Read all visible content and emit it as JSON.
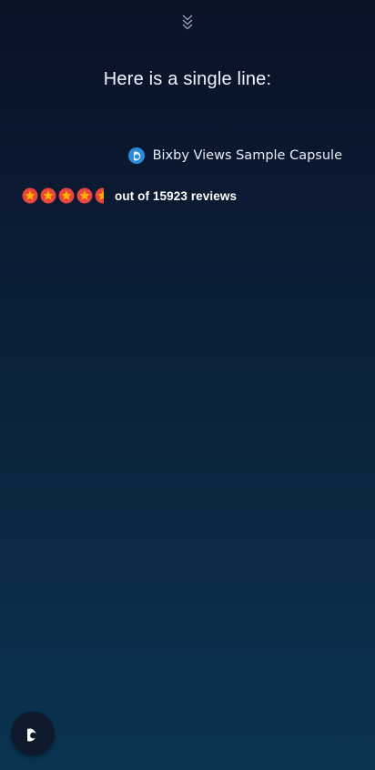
{
  "header": {
    "collapse_icon": "double-chevron-down-icon"
  },
  "content": {
    "headline": "Here is a single line:",
    "capsule": {
      "icon": "bixby-logo-icon",
      "name": "Bixby Views Sample Capsule"
    },
    "rating": {
      "stars_icon": "star-icon",
      "star_count": 5,
      "stars_filled": 4.5,
      "reviews_text": "out of 15923 reviews"
    }
  },
  "footer": {
    "bixby_button_icon": "bixby-icon"
  },
  "colors": {
    "bg_top": "#0a1226",
    "bg_bottom": "#0a3452",
    "star_fill": "#e8463c",
    "star_inner": "#ffb300",
    "capsule_icon_blue": "#2a8bd8"
  }
}
